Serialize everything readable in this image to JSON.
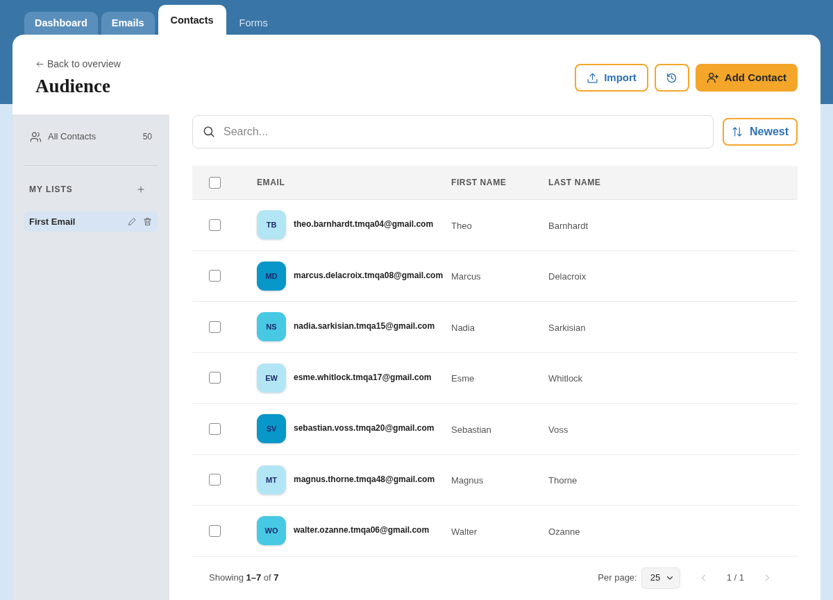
{
  "tabs": [
    {
      "label": "Dashboard",
      "selected": false,
      "disabled": false
    },
    {
      "label": "Emails",
      "selected": false,
      "disabled": false
    },
    {
      "label": "Contacts",
      "selected": true,
      "disabled": false
    },
    {
      "label": "Forms",
      "selected": false,
      "disabled": true
    }
  ],
  "header": {
    "back_link": "Back to overview",
    "title": "Audience",
    "actions": [
      {
        "kind": "import",
        "label": "Import"
      },
      {
        "kind": "history"
      },
      {
        "kind": "add_contact",
        "label": "Add Contact"
      }
    ]
  },
  "sidebar": {
    "all_contacts": {
      "label": "All Contacts",
      "count": "50"
    },
    "lists_heading": "MY LISTS",
    "lists": [
      {
        "label": "First Email",
        "selected": true
      }
    ]
  },
  "search": {
    "placeholder": "Search..."
  },
  "sort_button": {
    "label": "Newest"
  },
  "table": {
    "select_all": {
      "checked": false
    },
    "columns": [
      "EMAIL",
      "FIRST NAME",
      "LAST NAME"
    ],
    "rows": [
      {
        "checked": false,
        "initials": "TB",
        "color": "#b3e6f4",
        "email": "theo.barnhardt.tmqa04@gmail.com",
        "first_name": "Theo",
        "last_name": "Barnhardt"
      },
      {
        "checked": false,
        "initials": "MD",
        "color": "#0797c9",
        "email": "marcus.delacroix.tmqa08@gmail.com",
        "first_name": "Marcus",
        "last_name": "Delacroix"
      },
      {
        "checked": false,
        "initials": "NS",
        "color": "#47c9e3",
        "email": "nadia.sarkisian.tmqa15@gmail.com",
        "first_name": "Nadia",
        "last_name": "Sarkisian"
      },
      {
        "checked": false,
        "initials": "EW",
        "color": "#b3e6f4",
        "email": "esme.whitlock.tmqa17@gmail.com",
        "first_name": "Esme",
        "last_name": "Whitlock"
      },
      {
        "checked": false,
        "initials": "SV",
        "color": "#0797c9",
        "email": "sebastian.voss.tmqa20@gmail.com",
        "first_name": "Sebastian",
        "last_name": "Voss"
      },
      {
        "checked": false,
        "initials": "MT",
        "color": "#b3e6f4",
        "email": "magnus.thorne.tmqa48@gmail.com",
        "first_name": "Magnus",
        "last_name": "Thorne"
      },
      {
        "checked": false,
        "initials": "WO",
        "color": "#47c9e3",
        "email": "walter.ozanne.tmqa06@gmail.com",
        "first_name": "Walter",
        "last_name": "Ozanne"
      }
    ]
  },
  "footer": {
    "summary": "Showing **1–7** of **7**",
    "per_page_label": "Per page:",
    "per_page": "25",
    "page": "1 / 1"
  }
}
